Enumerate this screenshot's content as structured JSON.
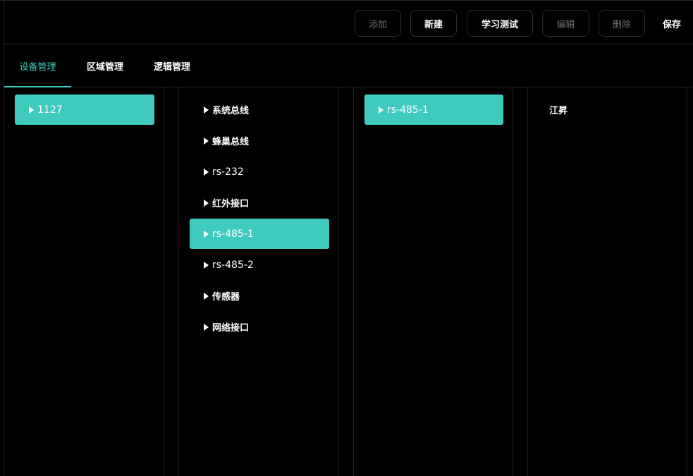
{
  "toolbar": {
    "add": "添加",
    "new": "新建",
    "learn_test": "学习测试",
    "edit": "编辑",
    "delete": "删除",
    "save": "保存"
  },
  "tabs": [
    {
      "label": "设备管理",
      "active": true
    },
    {
      "label": "区域管理",
      "active": false
    },
    {
      "label": "逻辑管理",
      "active": false
    }
  ],
  "columns": {
    "devices": [
      {
        "label": "1127",
        "selected": true
      }
    ],
    "interfaces": [
      {
        "label": "系统总线",
        "selected": false
      },
      {
        "label": "蜂巢总线",
        "selected": false
      },
      {
        "label": "rs-232",
        "selected": false
      },
      {
        "label": "红外接口",
        "selected": false
      },
      {
        "label": "rs-485-1",
        "selected": true
      },
      {
        "label": "rs-485-2",
        "selected": false
      },
      {
        "label": "传感器",
        "selected": false
      },
      {
        "label": "网络接口",
        "selected": false
      }
    ],
    "ports": [
      {
        "label": "rs-485-1",
        "selected": true
      }
    ],
    "entries": [
      {
        "label": "江昇"
      }
    ]
  },
  "colors": {
    "accent": "#3ecbbd",
    "background": "#000000",
    "border": "#262626",
    "disabled_text": "#6f6f6f"
  },
  "icons": {
    "tree_item": "caret-right-icon"
  }
}
